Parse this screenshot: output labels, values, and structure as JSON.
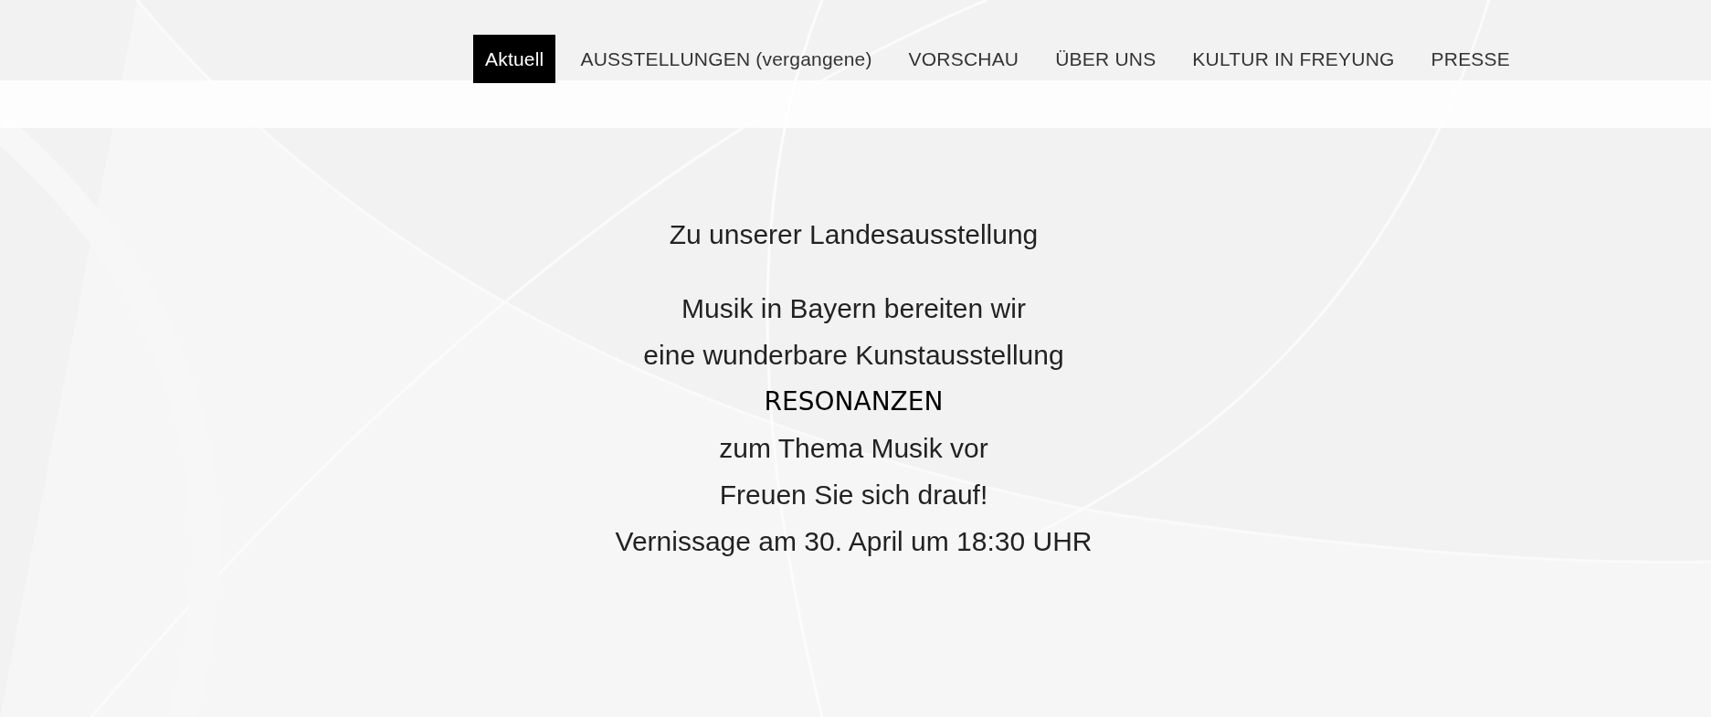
{
  "nav": [
    {
      "label": "Aktuell",
      "selected": true
    },
    {
      "label": "AUSSTELLUNGEN (vergangene)",
      "selected": false
    },
    {
      "label": "VORSCHAU",
      "selected": false
    },
    {
      "label": "ÜBER UNS",
      "selected": false
    },
    {
      "label": "KULTUR IN FREYUNG",
      "selected": false
    },
    {
      "label": "PRESSE",
      "selected": false
    }
  ],
  "content": [
    {
      "kind": "intro",
      "text": "Zu unserer Landesausstellung"
    },
    {
      "kind": "text",
      "text": "Musik in Bayern bereiten wir"
    },
    {
      "kind": "text",
      "text": "eine wunderbare Kunstausstellung"
    },
    {
      "kind": "heading",
      "text": "RESONANZEN"
    },
    {
      "kind": "text",
      "text": "zum Thema Musik vor"
    },
    {
      "kind": "text",
      "text": "Freuen Sie sich drauf!"
    },
    {
      "kind": "text",
      "text": "Vernissage am 30. April um 18:30 UHR"
    }
  ]
}
